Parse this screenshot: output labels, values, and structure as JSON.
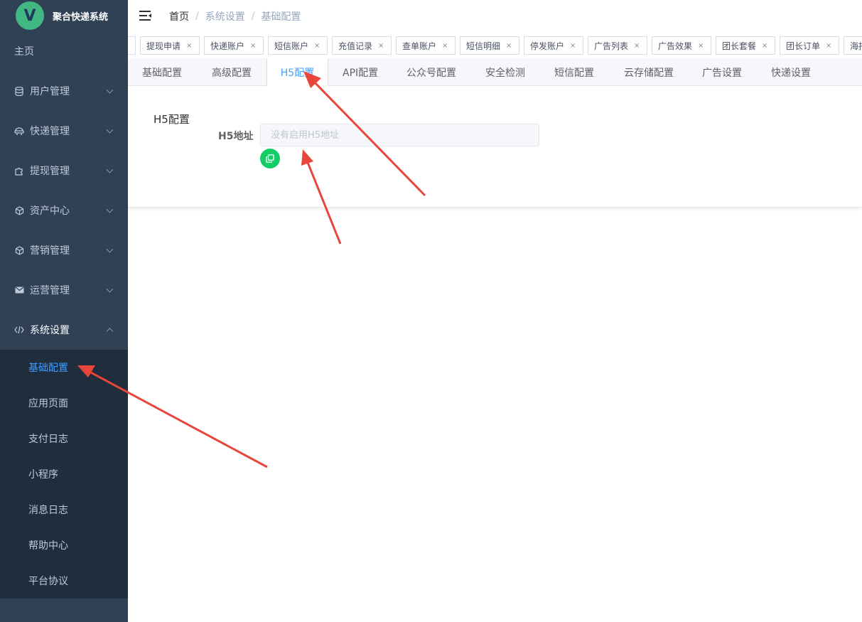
{
  "app": {
    "title": "聚合快递系统",
    "logo_letter": "V"
  },
  "sidebar": {
    "home": "主页",
    "groups": [
      {
        "label": "用户管理",
        "icon": "database-icon"
      },
      {
        "label": "快递管理",
        "icon": "courier-icon"
      },
      {
        "label": "提现管理",
        "icon": "puzzle-icon"
      },
      {
        "label": "资产中心",
        "icon": "cube-icon"
      },
      {
        "label": "营销管理",
        "icon": "cube-icon"
      },
      {
        "label": "运营管理",
        "icon": "mail-icon"
      },
      {
        "label": "系统设置",
        "icon": "code-icon"
      }
    ],
    "submenu": [
      "基础配置",
      "应用页面",
      "支付日志",
      "小程序",
      "消息日志",
      "帮助中心",
      "平台协议"
    ],
    "active_submenu": "基础配置"
  },
  "breadcrumb": {
    "home": "首页",
    "sep": "/",
    "level2": "系统设置",
    "level3": "基础配置"
  },
  "tags": [
    "提现申请",
    "快递账户",
    "短信账户",
    "充值记录",
    "查单账户",
    "短信明细",
    "停发账户",
    "广告列表",
    "广告效果",
    "团长套餐",
    "团长订单",
    "海报"
  ],
  "tag_close": "×",
  "tabs": [
    "基础配置",
    "高级配置",
    "H5配置",
    "API配置",
    "公众号配置",
    "安全检测",
    "短信配置",
    "云存储配置",
    "广告设置",
    "快递设置"
  ],
  "active_tab": "H5配置",
  "form": {
    "section_title": "H5配置",
    "field_label": "H5地址",
    "field_value": "",
    "field_placeholder": "没有启用H5地址"
  },
  "colors": {
    "sidebar_bg": "#304156",
    "submenu_bg": "#1f2d3d",
    "accent": "#409eff",
    "copy_button": "#13ce66",
    "annotation": "#e8453c"
  }
}
